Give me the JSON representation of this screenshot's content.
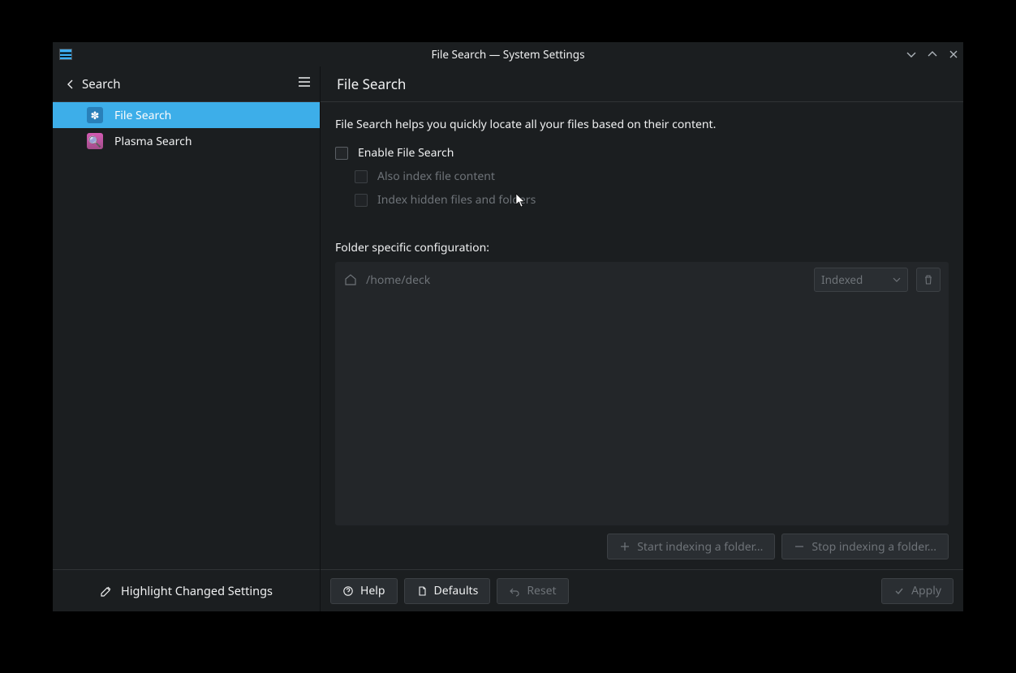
{
  "window": {
    "title": "File Search — System Settings"
  },
  "sidebar": {
    "back_label": "Search",
    "items": [
      {
        "label": "File Search"
      },
      {
        "label": "Plasma Search"
      }
    ],
    "footer_label": "Highlight Changed Settings"
  },
  "main": {
    "title": "File Search",
    "description": "File Search helps you quickly locate all your files based on their content.",
    "checks": {
      "enable_label": "Enable File Search",
      "index_content_label": "Also index file content",
      "index_hidden_label": "Index hidden files and folders"
    },
    "folder_section_label": "Folder specific configuration:",
    "folders": [
      {
        "path": "/home/deck",
        "mode": "Indexed"
      }
    ],
    "folder_actions": {
      "start_label": "Start indexing a folder...",
      "stop_label": "Stop indexing a folder..."
    }
  },
  "footer": {
    "help_label": "Help",
    "defaults_label": "Defaults",
    "reset_label": "Reset",
    "apply_label": "Apply"
  }
}
